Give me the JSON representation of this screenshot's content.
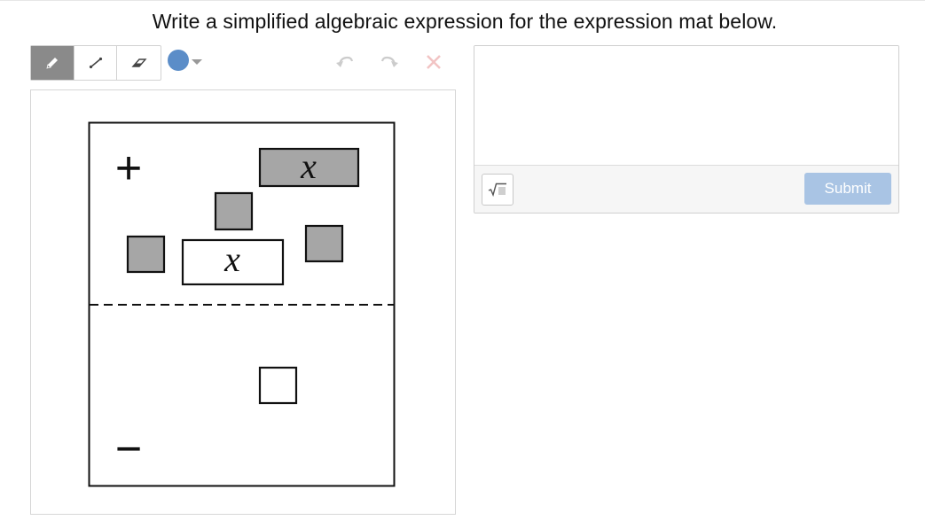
{
  "prompt": {
    "text": "Write a simplified algebraic expression for the expression mat below."
  },
  "toolbar": {
    "tools": [
      {
        "name": "pencil-tool",
        "icon": "pencil-icon",
        "active": true
      },
      {
        "name": "line-tool",
        "icon": "line-icon",
        "active": false
      },
      {
        "name": "eraser-tool",
        "icon": "eraser-icon",
        "active": false
      }
    ],
    "color": "#5b8dc8",
    "color_picker_icon": "chevron-down-icon",
    "undo_icon": "undo-icon",
    "redo_icon": "redo-icon",
    "clear_icon": "close-icon",
    "disabled_color": "#cccccc",
    "clear_color": "#f2c4c4"
  },
  "mat": {
    "positive_sign": "+",
    "negative_sign": "−",
    "variable_label": "x",
    "positive_region": {
      "x_tiles_positive": 1,
      "x_tiles_negative": 1,
      "unit_tiles_positive": 3,
      "unit_tiles_negative": 0
    },
    "negative_region": {
      "x_tiles_positive": 0,
      "x_tiles_negative": 0,
      "unit_tiles_positive": 0,
      "unit_tiles_negative": 1
    },
    "positive_tile_fill": "#a6a6a6",
    "negative_tile_fill": "#ffffff"
  },
  "answer": {
    "value": "",
    "placeholder": "",
    "math_icon": "square-root-icon",
    "submit_label": "Submit",
    "submit_color": "#a9c4e4"
  }
}
